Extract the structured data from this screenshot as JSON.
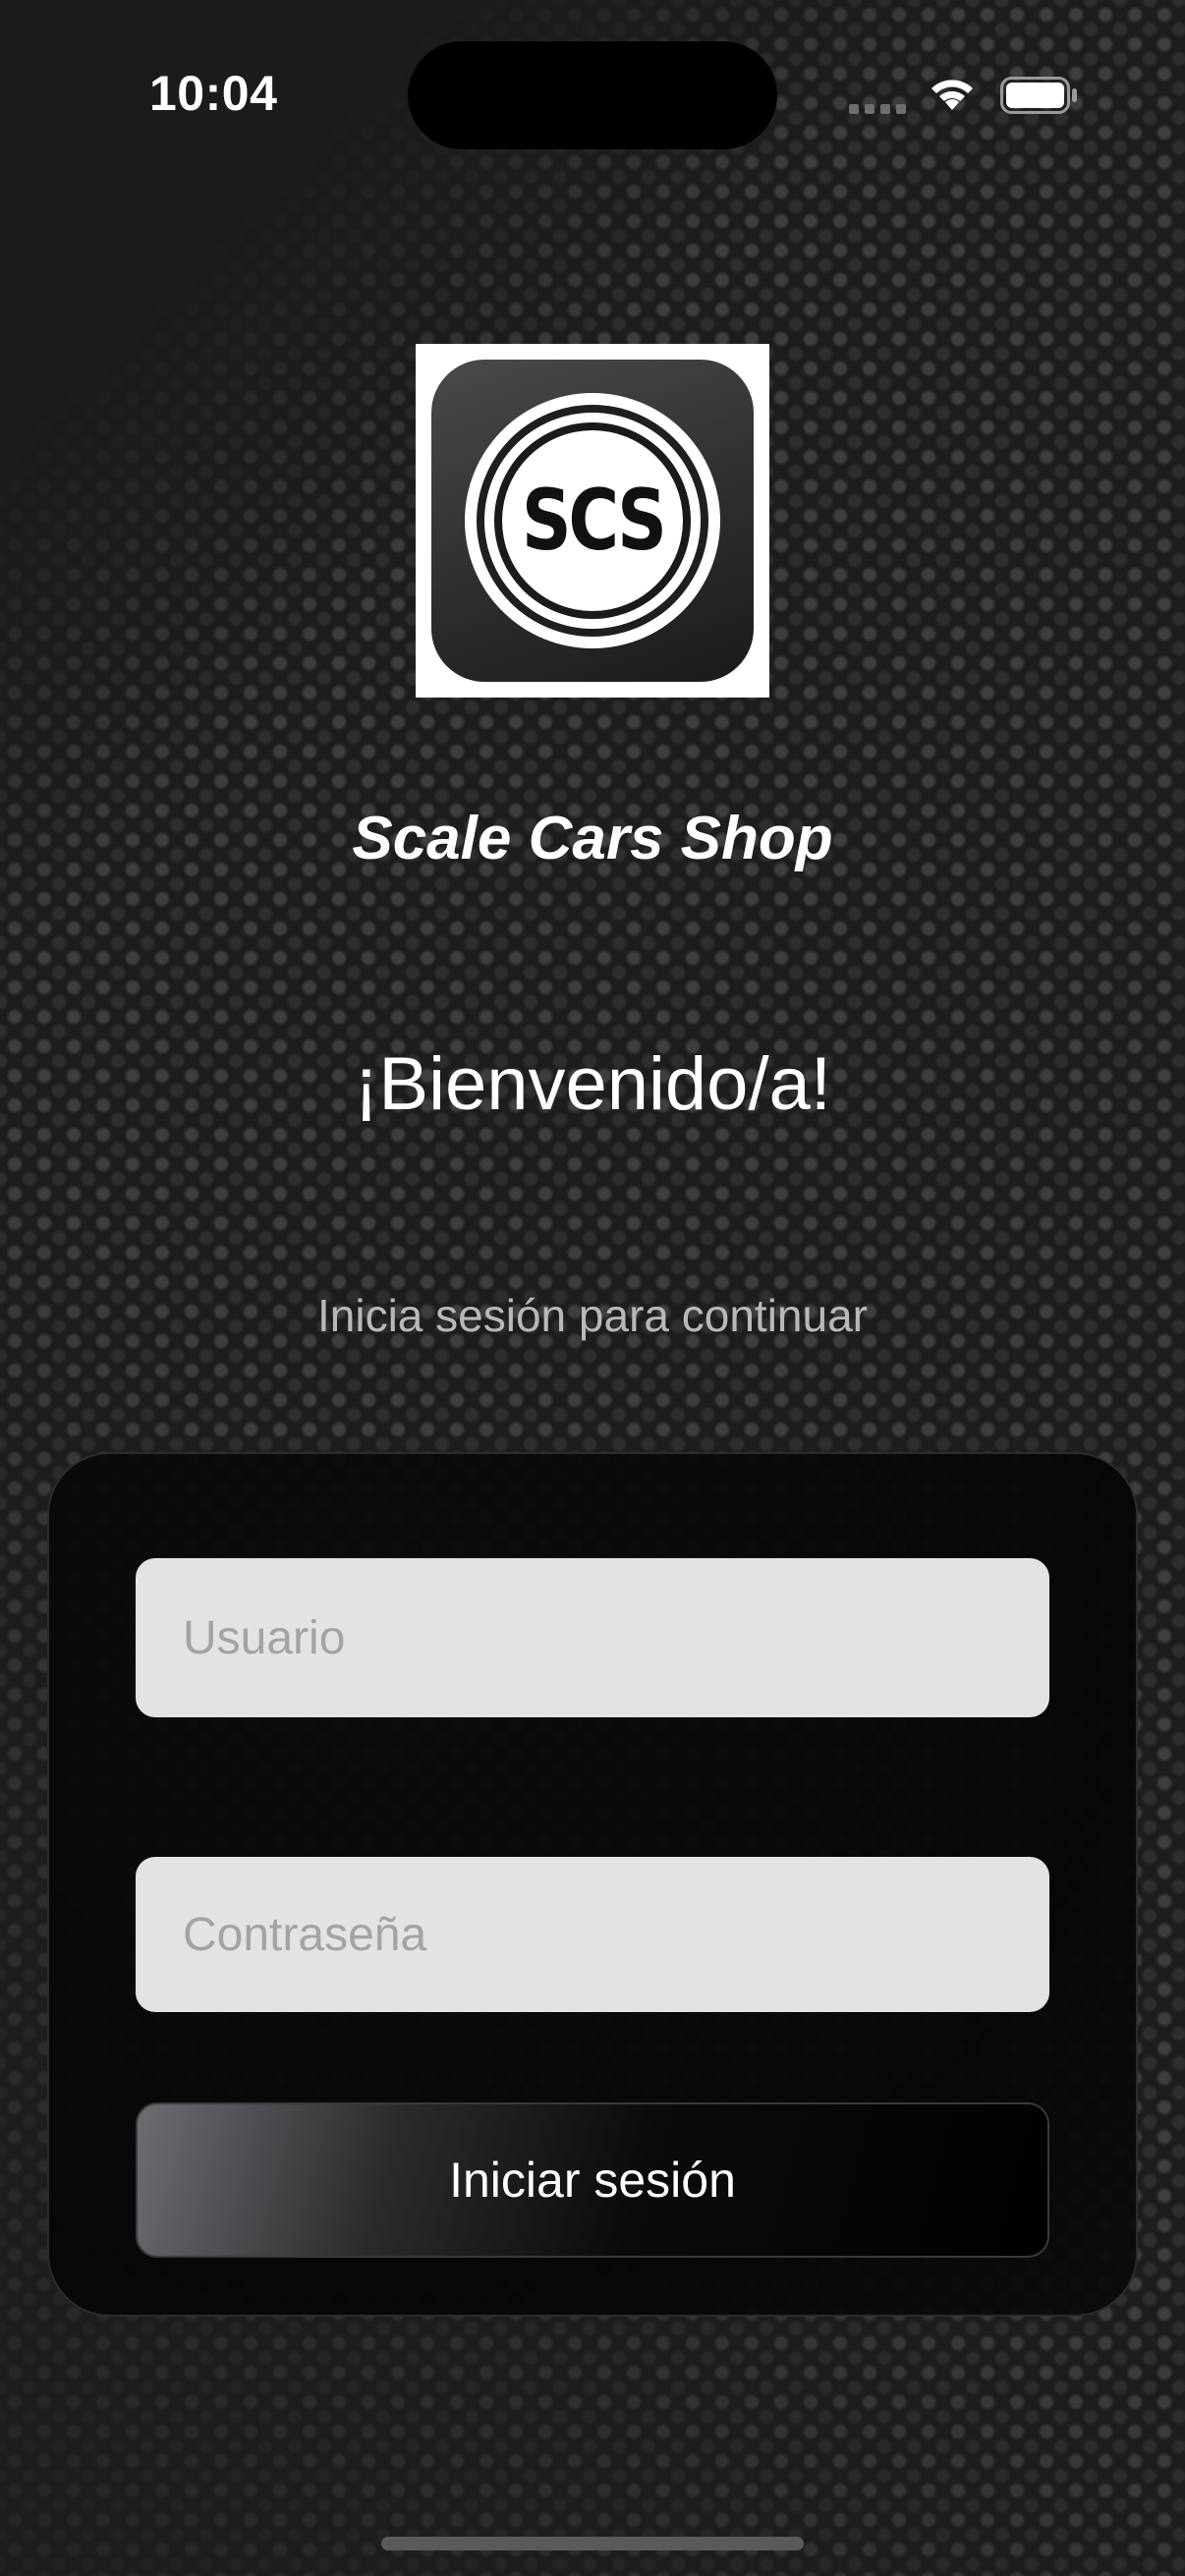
{
  "status_bar": {
    "time": "10:04"
  },
  "logo": {
    "text": "SCS"
  },
  "brand": {
    "title": "Scale Cars Shop"
  },
  "welcome": {
    "heading": "¡Bienvenido/a!",
    "subtitle": "Inicia sesión para continuar"
  },
  "login_form": {
    "username_placeholder": "Usuario",
    "username_value": "",
    "password_placeholder": "Contraseña",
    "password_value": "",
    "submit_label": "Iniciar sesión"
  },
  "colors": {
    "background": "#1d1d1d",
    "field_background": "#e3e3e3",
    "placeholder": "#a3a3a3",
    "text_primary": "#ffffff",
    "text_secondary": "#b9b9b9"
  },
  "icons": [
    "wifi-icon",
    "battery-icon",
    "signal-icon"
  ]
}
